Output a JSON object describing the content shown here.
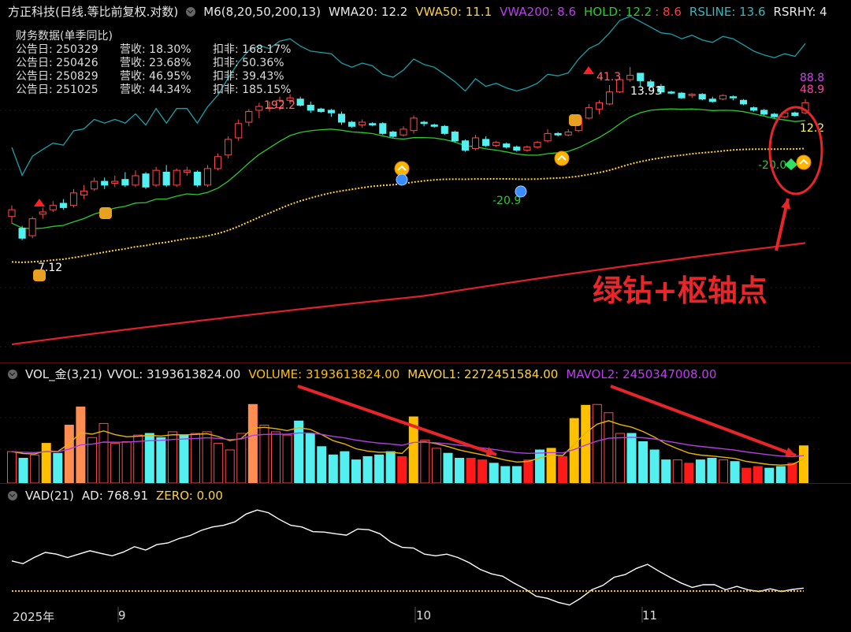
{
  "header": {
    "stock": "方正科技(日线.等比前复权.对数)",
    "ma_label": "M6(8,20,50,200,13)",
    "wma20": "WMA20: 12.2",
    "vwa50": "VWA50: 11.1",
    "vwa200": "VWA200: 8.6",
    "hold": "HOLD: 12.2",
    "hold2": ": 8.6",
    "rsline": "RSLINE: 13.6",
    "rsrhy": "RSRHY: 4"
  },
  "financial": {
    "title": "财务数据(单季同比)",
    "rows": [
      {
        "date": "公告日: 250329",
        "rev": "营收:  18.30%",
        "net": "扣非:  168.17%"
      },
      {
        "date": "公告日: 250426",
        "rev": "营收:  23.68%",
        "net": "扣非:  50.36%"
      },
      {
        "date": "公告日: 250829",
        "rev": "营收:  46.95%",
        "net": "扣非:  39.43%"
      },
      {
        "date": "公告日: 251025",
        "rev": "营收:  44.34%",
        "net": "扣非:  185.15%"
      }
    ]
  },
  "price_labels": {
    "low1": "7.12",
    "high1": "192.2",
    "high2": "41.3",
    "high3": "13.93",
    "low2": "-20.9",
    "low3": "-20.0",
    "rs_a": "88.8",
    "rs_b": "48.9",
    "wma_last": "12.2"
  },
  "annotation": "绿钻+枢轴点",
  "volume_header": {
    "name": "VOL_金(3,21)",
    "vvol": "VVOL: 3193613824.00",
    "volume": "VOLUME: 3193613824.00",
    "mavol1": "MAVOL1: 2272451584.00",
    "mavol2": "MAVOL2: 2450347008.00"
  },
  "vad_header": {
    "name": "VAD(21)",
    "ad": "AD: 768.91",
    "zero": "ZERO: 0.00"
  },
  "time_axis": {
    "year": "2025年",
    "m9": "9",
    "m10": "10",
    "m11": "11"
  },
  "colors": {
    "up": "#ff4a4a",
    "down": "#54f0f0",
    "wma": "#2cc92c",
    "vwa50": "#ffd23c",
    "vwa200": "#e0202a",
    "rsline": "#1aa0a8",
    "vad": "#ffffff",
    "vol_gold": "#ffc000",
    "vol_orange": "#ff8c50",
    "mavol1": "#e8b400",
    "mavol2": "#b040e0"
  },
  "chart_data": {
    "type": "candlestick",
    "candles": [
      [
        8.1,
        8.4,
        7.8,
        8.6
      ],
      [
        7.6,
        7.2,
        7.12,
        7.7
      ],
      [
        7.3,
        8.0,
        7.2,
        8.1
      ],
      [
        8.2,
        8.3,
        8.0,
        8.5
      ],
      [
        8.4,
        8.6,
        8.3,
        8.8
      ],
      [
        8.7,
        8.5,
        8.4,
        8.9
      ],
      [
        8.6,
        9.2,
        8.5,
        9.4
      ],
      [
        9.1,
        9.3,
        8.9,
        9.6
      ],
      [
        9.4,
        9.8,
        9.3,
        10.0
      ],
      [
        9.8,
        9.6,
        9.4,
        10.0
      ],
      [
        9.7,
        9.8,
        9.5,
        10.1
      ],
      [
        9.9,
        9.6,
        9.5,
        10.3
      ],
      [
        9.6,
        10.1,
        9.5,
        10.4
      ],
      [
        10.2,
        9.5,
        9.4,
        10.3
      ],
      [
        9.6,
        10.4,
        9.5,
        10.6
      ],
      [
        10.3,
        9.6,
        9.5,
        10.7
      ],
      [
        9.6,
        10.4,
        9.5,
        10.5
      ],
      [
        10.3,
        10.4,
        10.1,
        10.6
      ],
      [
        10.3,
        9.6,
        9.5,
        10.4
      ],
      [
        9.6,
        10.5,
        9.5,
        10.7
      ],
      [
        10.5,
        11.2,
        10.4,
        11.4
      ],
      [
        11.3,
        12.3,
        11.1,
        12.5
      ],
      [
        12.4,
        13.4,
        12.2,
        13.7
      ],
      [
        13.5,
        14.3,
        13.2,
        14.5
      ],
      [
        14.4,
        14.7,
        13.8,
        15.0
      ],
      [
        14.6,
        14.6,
        14.3,
        15.1
      ],
      [
        14.6,
        15.2,
        14.4,
        15.5
      ],
      [
        15.2,
        15.4,
        14.9,
        15.7
      ],
      [
        15.3,
        14.8,
        14.7,
        15.5
      ],
      [
        14.8,
        14.4,
        14.2,
        15.1
      ],
      [
        14.5,
        14.3,
        14.2,
        14.6
      ],
      [
        14.4,
        14.2,
        13.9,
        14.5
      ],
      [
        14.1,
        13.5,
        13.3,
        14.3
      ],
      [
        13.5,
        13.2,
        13.1,
        13.6
      ],
      [
        13.3,
        13.5,
        13.1,
        13.7
      ],
      [
        13.4,
        13.3,
        13.2,
        13.5
      ],
      [
        13.4,
        12.7,
        12.6,
        13.5
      ],
      [
        12.8,
        12.5,
        12.4,
        12.9
      ],
      [
        12.6,
        13.0,
        12.5,
        13.2
      ],
      [
        12.9,
        13.8,
        12.7,
        14.0
      ],
      [
        13.5,
        13.4,
        13.2,
        13.6
      ],
      [
        13.3,
        13.2,
        13.1,
        13.4
      ],
      [
        13.2,
        12.7,
        12.6,
        13.3
      ],
      [
        12.8,
        12.2,
        12.1,
        12.9
      ],
      [
        12.2,
        11.6,
        11.5,
        12.3
      ],
      [
        11.7,
        12.4,
        11.6,
        12.6
      ],
      [
        12.3,
        11.9,
        11.8,
        12.5
      ],
      [
        11.9,
        12.1,
        11.8,
        12.2
      ],
      [
        12.0,
        11.8,
        11.7,
        12.1
      ],
      [
        11.8,
        11.6,
        11.5,
        11.9
      ],
      [
        11.6,
        11.8,
        11.5,
        11.9
      ],
      [
        11.8,
        12.1,
        11.7,
        12.2
      ],
      [
        12.2,
        12.7,
        12.1,
        13.0
      ],
      [
        12.7,
        12.6,
        12.5,
        12.8
      ],
      [
        12.6,
        12.8,
        12.5,
        13.0
      ],
      [
        12.9,
        13.8,
        12.8,
        14.0
      ],
      [
        13.8,
        14.6,
        13.7,
        14.9
      ],
      [
        14.5,
        15.0,
        14.1,
        15.2
      ],
      [
        14.9,
        15.9,
        14.8,
        16.5
      ],
      [
        15.9,
        17.0,
        15.8,
        17.3
      ],
      [
        17.0,
        17.4,
        16.8,
        18.2
      ],
      [
        17.6,
        16.9,
        16.4,
        17.6
      ],
      [
        16.8,
        16.4,
        16.2,
        17.0
      ],
      [
        16.4,
        15.9,
        15.7,
        16.6
      ],
      [
        15.9,
        15.8,
        15.7,
        16.0
      ],
      [
        15.8,
        15.4,
        15.3,
        15.9
      ],
      [
        15.6,
        15.7,
        15.4,
        15.8
      ],
      [
        15.7,
        15.3,
        15.2,
        15.8
      ],
      [
        15.3,
        15.1,
        15.0,
        15.5
      ],
      [
        15.3,
        15.6,
        15.2,
        15.7
      ],
      [
        15.5,
        15.4,
        15.2,
        15.6
      ],
      [
        15.2,
        14.9,
        14.8,
        15.3
      ],
      [
        14.6,
        14.4,
        14.3,
        14.7
      ],
      [
        14.4,
        14.1,
        14.0,
        14.5
      ],
      [
        14.1,
        13.9,
        13.8,
        14.2
      ],
      [
        13.9,
        14.2,
        13.8,
        14.3
      ],
      [
        14.2,
        14.0,
        13.9,
        14.3
      ],
      [
        14.2,
        15.0,
        14.1,
        15.3
      ]
    ],
    "volume": [
      [
        38,
        "up"
      ],
      [
        30,
        "down"
      ],
      [
        34,
        "up"
      ],
      [
        48,
        "gold"
      ],
      [
        36,
        "down"
      ],
      [
        70,
        "orange"
      ],
      [
        92,
        "orange"
      ],
      [
        55,
        "up"
      ],
      [
        72,
        "up"
      ],
      [
        48,
        "up"
      ],
      [
        50,
        "up"
      ],
      [
        58,
        "up"
      ],
      [
        60,
        "down"
      ],
      [
        55,
        "down"
      ],
      [
        62,
        "up"
      ],
      [
        58,
        "down"
      ],
      [
        60,
        "up"
      ],
      [
        62,
        "up"
      ],
      [
        48,
        "up"
      ],
      [
        40,
        "up"
      ],
      [
        60,
        "up"
      ],
      [
        95,
        "orange"
      ],
      [
        70,
        "up"
      ],
      [
        62,
        "up"
      ],
      [
        58,
        "up"
      ],
      [
        75,
        "down"
      ],
      [
        60,
        "down"
      ],
      [
        44,
        "down"
      ],
      [
        34,
        "down"
      ],
      [
        38,
        "down"
      ],
      [
        28,
        "down"
      ],
      [
        32,
        "down"
      ],
      [
        34,
        "down"
      ],
      [
        38,
        "down"
      ],
      [
        32,
        "red"
      ],
      [
        80,
        "gold"
      ],
      [
        52,
        "up"
      ],
      [
        42,
        "up"
      ],
      [
        36,
        "down"
      ],
      [
        30,
        "down"
      ],
      [
        30,
        "red"
      ],
      [
        28,
        "red"
      ],
      [
        24,
        "down"
      ],
      [
        20,
        "down"
      ],
      [
        20,
        "down"
      ],
      [
        28,
        "red"
      ],
      [
        40,
        "down"
      ],
      [
        42,
        "gold"
      ],
      [
        32,
        "red"
      ],
      [
        78,
        "gold"
      ],
      [
        94,
        "gold"
      ],
      [
        95,
        "up"
      ],
      [
        85,
        "up"
      ],
      [
        60,
        "up"
      ],
      [
        60,
        "down"
      ],
      [
        50,
        "down"
      ],
      [
        40,
        "down"
      ],
      [
        28,
        "down"
      ],
      [
        28,
        "up"
      ],
      [
        24,
        "red"
      ],
      [
        28,
        "down"
      ],
      [
        30,
        "down"
      ],
      [
        28,
        "up"
      ],
      [
        26,
        "down"
      ],
      [
        18,
        "red"
      ],
      [
        20,
        "red"
      ],
      [
        18,
        "down"
      ],
      [
        20,
        "down"
      ],
      [
        24,
        "red"
      ],
      [
        45,
        "gold"
      ]
    ],
    "vad": [
      630,
      622,
      640,
      655,
      650,
      640,
      650,
      660,
      652,
      645,
      656,
      672,
      662,
      678,
      683,
      696,
      705,
      720,
      730,
      735,
      745,
      768,
      780,
      772,
      752,
      735,
      730,
      716,
      715,
      710,
      706,
      724,
      722,
      710,
      685,
      670,
      668,
      650,
      645,
      650,
      640,
      625,
      605,
      592,
      585,
      565,
      548,
      526,
      520,
      508,
      500,
      520,
      545,
      558,
      582,
      590,
      608,
      620,
      600,
      582,
      565,
      552,
      560,
      560,
      545,
      555,
      545,
      540,
      548,
      540,
      546,
      550
    ],
    "zero_level": 0,
    "annotation_text": "绿钻+枢轴点"
  }
}
